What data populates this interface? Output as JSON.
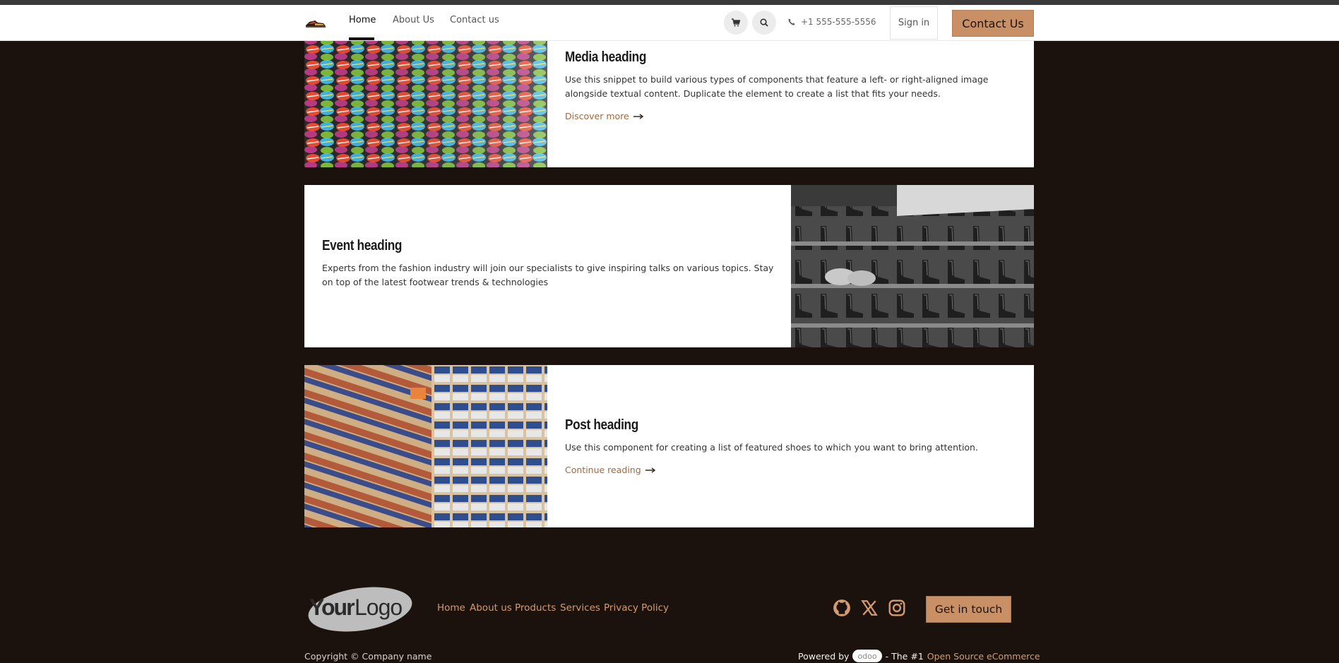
{
  "nav": {
    "links": [
      "Home",
      "About Us",
      "Contact us"
    ],
    "phone": "+1 555-555-5556",
    "signin": "Sign in",
    "contact": "Contact Us",
    "cart_icon": "cart-icon",
    "search_icon": "search-icon",
    "phone_icon": "phone-icon"
  },
  "cards": [
    {
      "title": "Media heading",
      "desc": "Use this snippet to build various types of components that feature a left- or right-aligned image alongside textual content. Duplicate the element to create a list that fits your needs.",
      "link": "Discover more"
    },
    {
      "title": "Event heading",
      "desc": "Experts from the fashion industry will join our specialists to give inspiring talks on various topics. Stay on top of the latest footwear trends & technologies"
    },
    {
      "title": "Post heading",
      "desc": "Use this component for creating a list of featured shoes to which you want to bring attention.",
      "link": "Continue reading"
    }
  ],
  "footer": {
    "logo_text": "YourLogo",
    "links": [
      "Home",
      "About us",
      "Products",
      "Services",
      "Privacy Policy"
    ],
    "social_icons": [
      "github-icon",
      "x-icon",
      "instagram-icon"
    ],
    "cta": "Get in touch",
    "copyright": "Copyright © Company name",
    "powered_prefix": "Powered by",
    "odoo": "odoo",
    "powered_mid": "- The #1",
    "powered_link": "Open Source eCommerce"
  },
  "colors": {
    "accent": "#c99066",
    "link": "#a0693e",
    "footer_link": "#d39b70",
    "background": "#1b120d"
  }
}
